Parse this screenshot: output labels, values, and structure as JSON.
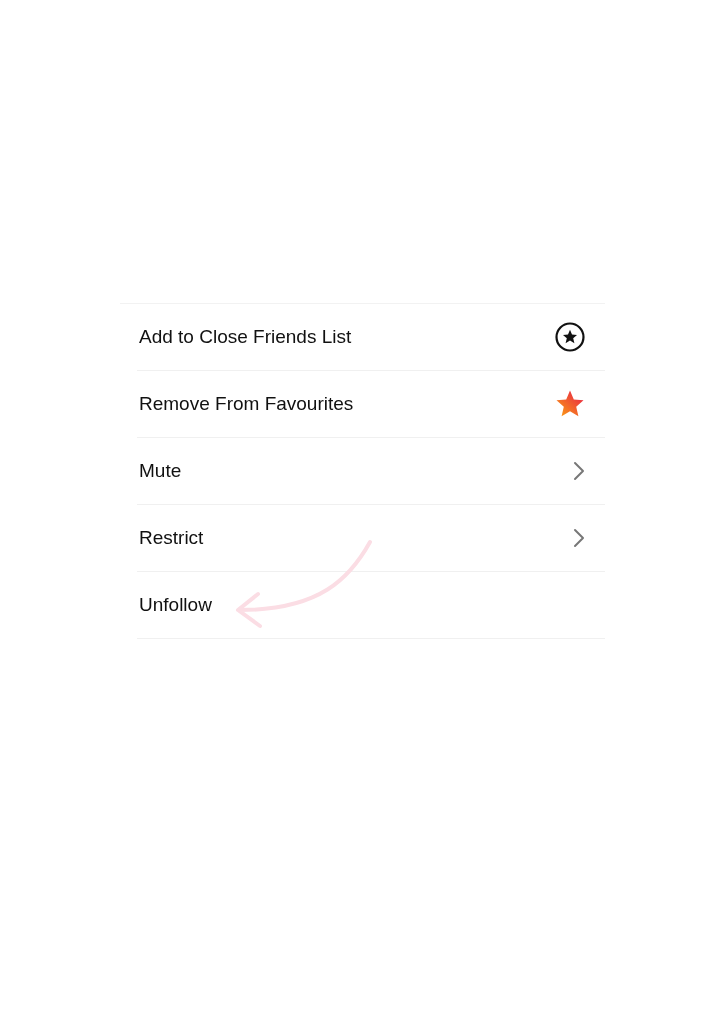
{
  "menu": {
    "items": [
      {
        "label": "Add to Close Friends List",
        "kind": "close-friends"
      },
      {
        "label": "Remove From Favourites",
        "kind": "favourite"
      },
      {
        "label": "Mute",
        "kind": "submenu"
      },
      {
        "label": "Restrict",
        "kind": "submenu"
      },
      {
        "label": "Unfollow",
        "kind": "plain"
      }
    ]
  }
}
